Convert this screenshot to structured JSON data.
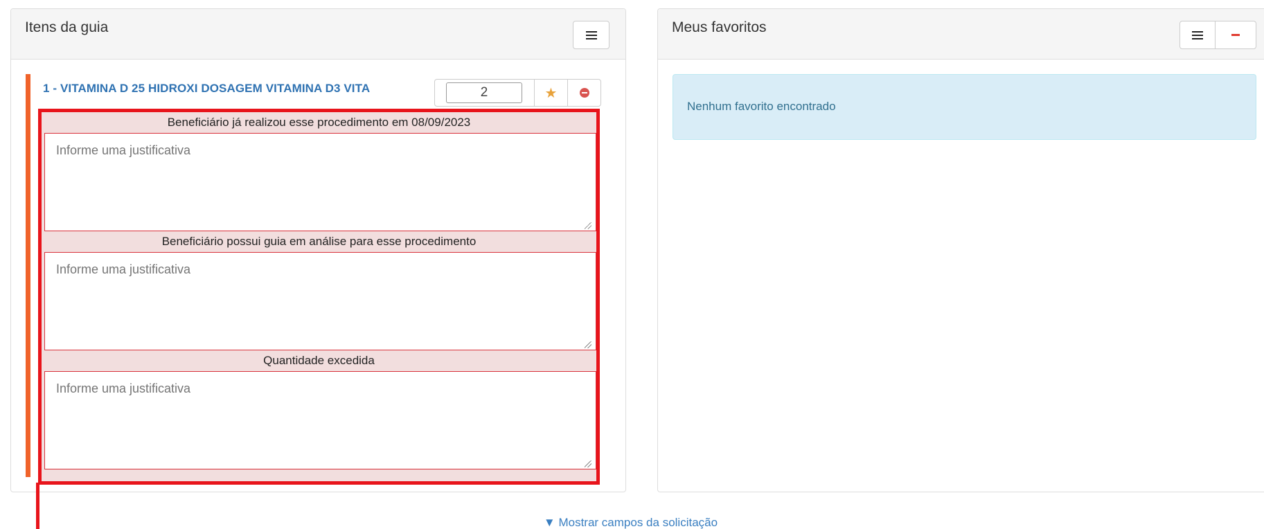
{
  "guide_panel": {
    "title": "Itens da guia",
    "item": {
      "title": "1 - VITAMINA D 25 HIDROXI DOSAGEM VITAMINA D3 VITA",
      "quantity": "2"
    },
    "alerts": [
      {
        "message": "Beneficiário já realizou esse procedimento em 08/09/2023",
        "placeholder": "Informe uma justificativa"
      },
      {
        "message": "Beneficiário possui guia em análise para esse procedimento",
        "placeholder": "Informe uma justificativa"
      },
      {
        "message": "Quantidade excedida",
        "placeholder": "Informe uma justificativa"
      }
    ]
  },
  "favorites_panel": {
    "title": "Meus favoritos",
    "empty_message": "Nenhum favorito encontrado"
  },
  "footer": {
    "toggle_label": "▼ Mostrar campos da solicitação"
  },
  "colors": {
    "accent_bar": "#f0632a",
    "alert_border": "#e8141b",
    "link": "#3a7fc1",
    "info_bg": "#d9edf7"
  },
  "icons": {
    "menu": "menu-icon",
    "minus": "minus-icon",
    "star": "star-icon",
    "remove": "remove-circle-icon"
  }
}
